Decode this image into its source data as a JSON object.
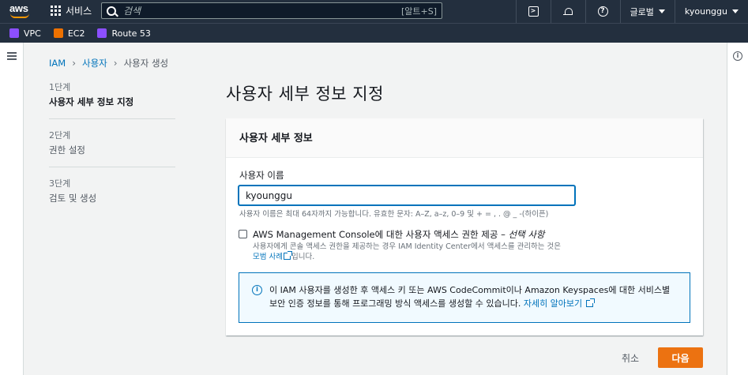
{
  "topnav": {
    "logo": "aws",
    "services_label": "서비스",
    "search_placeholder": "검색",
    "search_shortcut": "[알트+S]",
    "region_label": "글로벌",
    "account_label": "kyounggu"
  },
  "favorites": [
    {
      "label": "VPC",
      "color": "#8c4fff"
    },
    {
      "label": "EC2",
      "color": "#ed7100"
    },
    {
      "label": "Route 53",
      "color": "#8c4fff"
    }
  ],
  "breadcrumb": {
    "items": [
      "IAM",
      "사용자"
    ],
    "current": "사용자 생성"
  },
  "steps": [
    {
      "num": "1단계",
      "title": "사용자 세부 정보 지정"
    },
    {
      "num": "2단계",
      "title": "권한 설정"
    },
    {
      "num": "3단계",
      "title": "검토 및 생성"
    }
  ],
  "page": {
    "title": "사용자 세부 정보 지정"
  },
  "card": {
    "header": "사용자 세부 정보",
    "field_label": "사용자 이름",
    "username_value": "kyounggu",
    "hint": "사용자 이름은 최대 64자까지 가능합니다. 유효한 문자: A–Z, a–z, 0–9 및 + = , . @ _ -(하이픈)",
    "console_label": "AWS Management Console에 대한 사용자 액세스 권한 제공 – ",
    "console_optional": "선택 사항",
    "console_desc": "사용자에게 콘솔 액세스 권한을 제공하는 경우 IAM Identity Center에서 액세스를 관리하는 것은 ",
    "console_desc_link": "모범 사례",
    "console_desc_tail": "입니다.",
    "alert_text": "이 IAM 사용자를 생성한 후 액세스 키 또는 AWS CodeCommit이나 Amazon Keyspaces에 대한 서비스별 보안 인증 정보를 통해 프로그래밍 방식 액세스를 생성할 수 있습니다. ",
    "alert_link": "자세히 알아보기"
  },
  "footer": {
    "cancel": "취소",
    "next": "다음"
  },
  "colors": {
    "nav_bg": "#232f3e",
    "primary_button": "#ec7211",
    "link": "#0073bb"
  }
}
